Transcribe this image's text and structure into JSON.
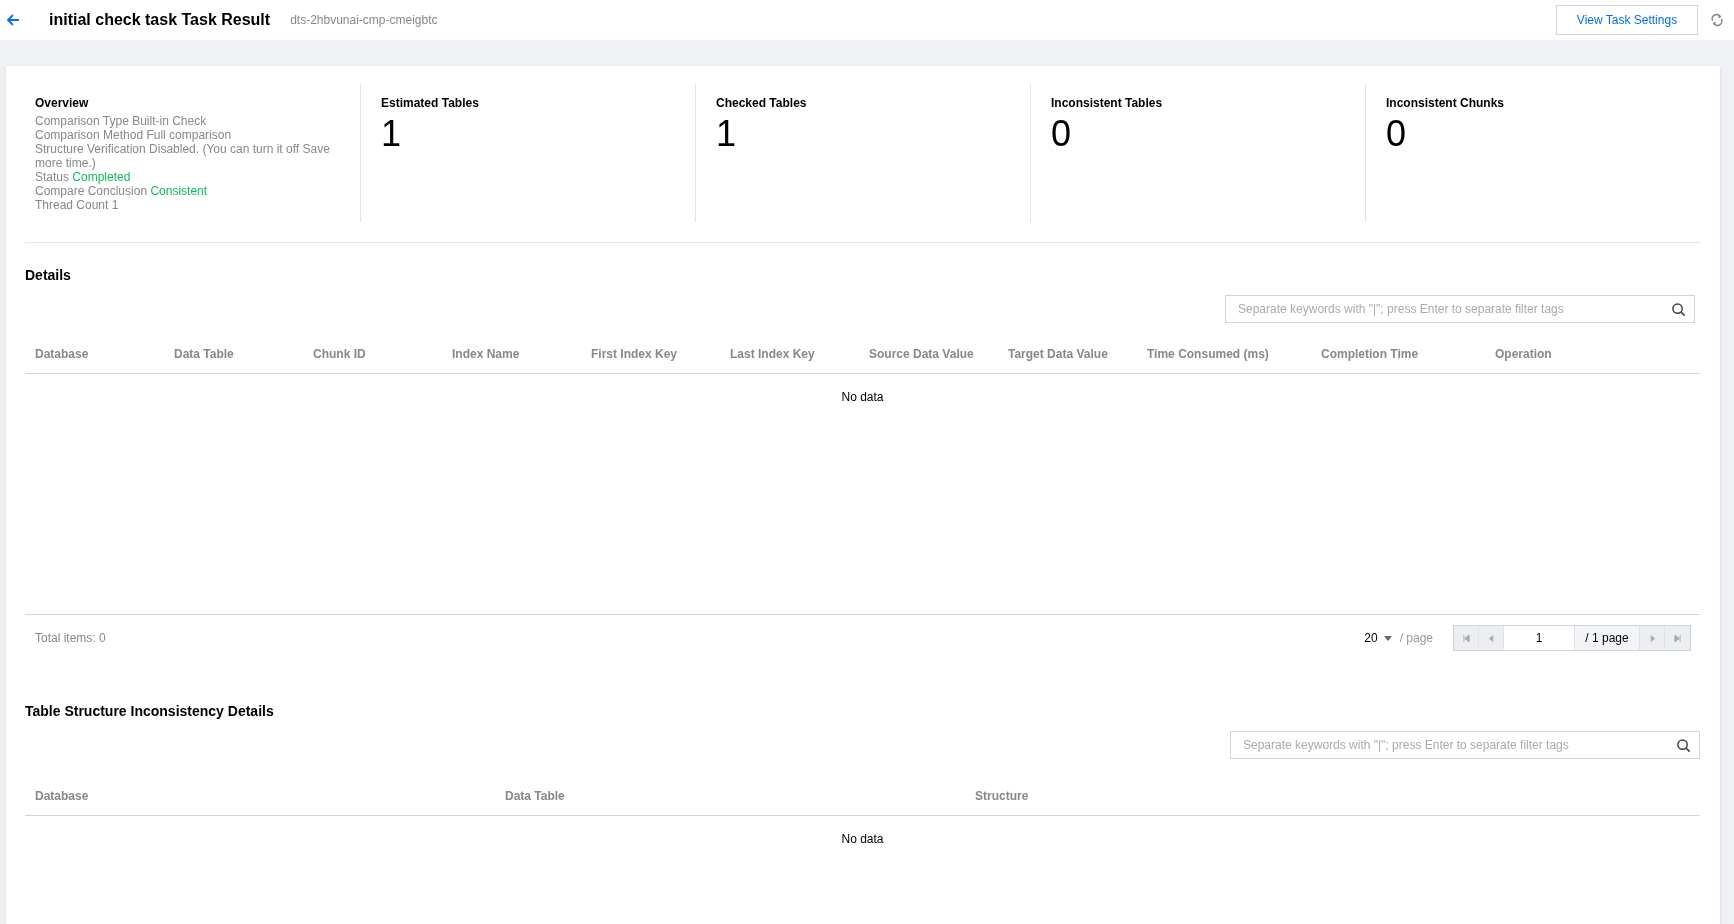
{
  "header": {
    "title": "initial check task Task Result",
    "task_id": "dts-2hbvunai-cmp-cmeigbtc",
    "settings_button": "View Task Settings"
  },
  "overview": {
    "title": "Overview",
    "rows": [
      {
        "label": "Comparison Type",
        "value": "Built-in Check",
        "highlighted": false
      },
      {
        "label": "Comparison Method",
        "value": "Full comparison",
        "highlighted": false
      },
      {
        "label": "Structure Verification",
        "value": "Disabled. (You can turn it off Save more time.)",
        "highlighted": false
      },
      {
        "label": "Status",
        "value": "Completed",
        "highlighted": true
      },
      {
        "label": "Compare Conclusion",
        "value": "Consistent",
        "highlighted": true
      },
      {
        "label": "Thread Count",
        "value": "1",
        "highlighted": false
      }
    ]
  },
  "stats": [
    {
      "label": "Estimated Tables",
      "value": "1"
    },
    {
      "label": "Checked Tables",
      "value": "1"
    },
    {
      "label": "Inconsistent Tables",
      "value": "0"
    },
    {
      "label": "Inconsistent Chunks",
      "value": "0"
    }
  ],
  "details": {
    "title": "Details",
    "search": {
      "placeholder": "Separate keywords with \"|\"; press Enter to separate filter tags"
    },
    "columns": [
      "Database",
      "Data Table",
      "Chunk ID",
      "Index Name",
      "First Index Key",
      "Last Index Key",
      "Source Data Value",
      "Target Data Value",
      "Time Consumed (ms)",
      "Completion Time",
      "Operation"
    ],
    "empty": "No data",
    "total": "Total items:  0",
    "page_size": "20",
    "per_page": "/ page",
    "page": "1",
    "page_count": "/ 1 page"
  },
  "structure": {
    "title": "Table Structure Inconsistency Details",
    "search": {
      "placeholder": "Separate keywords with \"|\"; press Enter to separate filter tags"
    },
    "columns": [
      "Database",
      "Data Table",
      "Structure"
    ],
    "empty": "No data"
  }
}
